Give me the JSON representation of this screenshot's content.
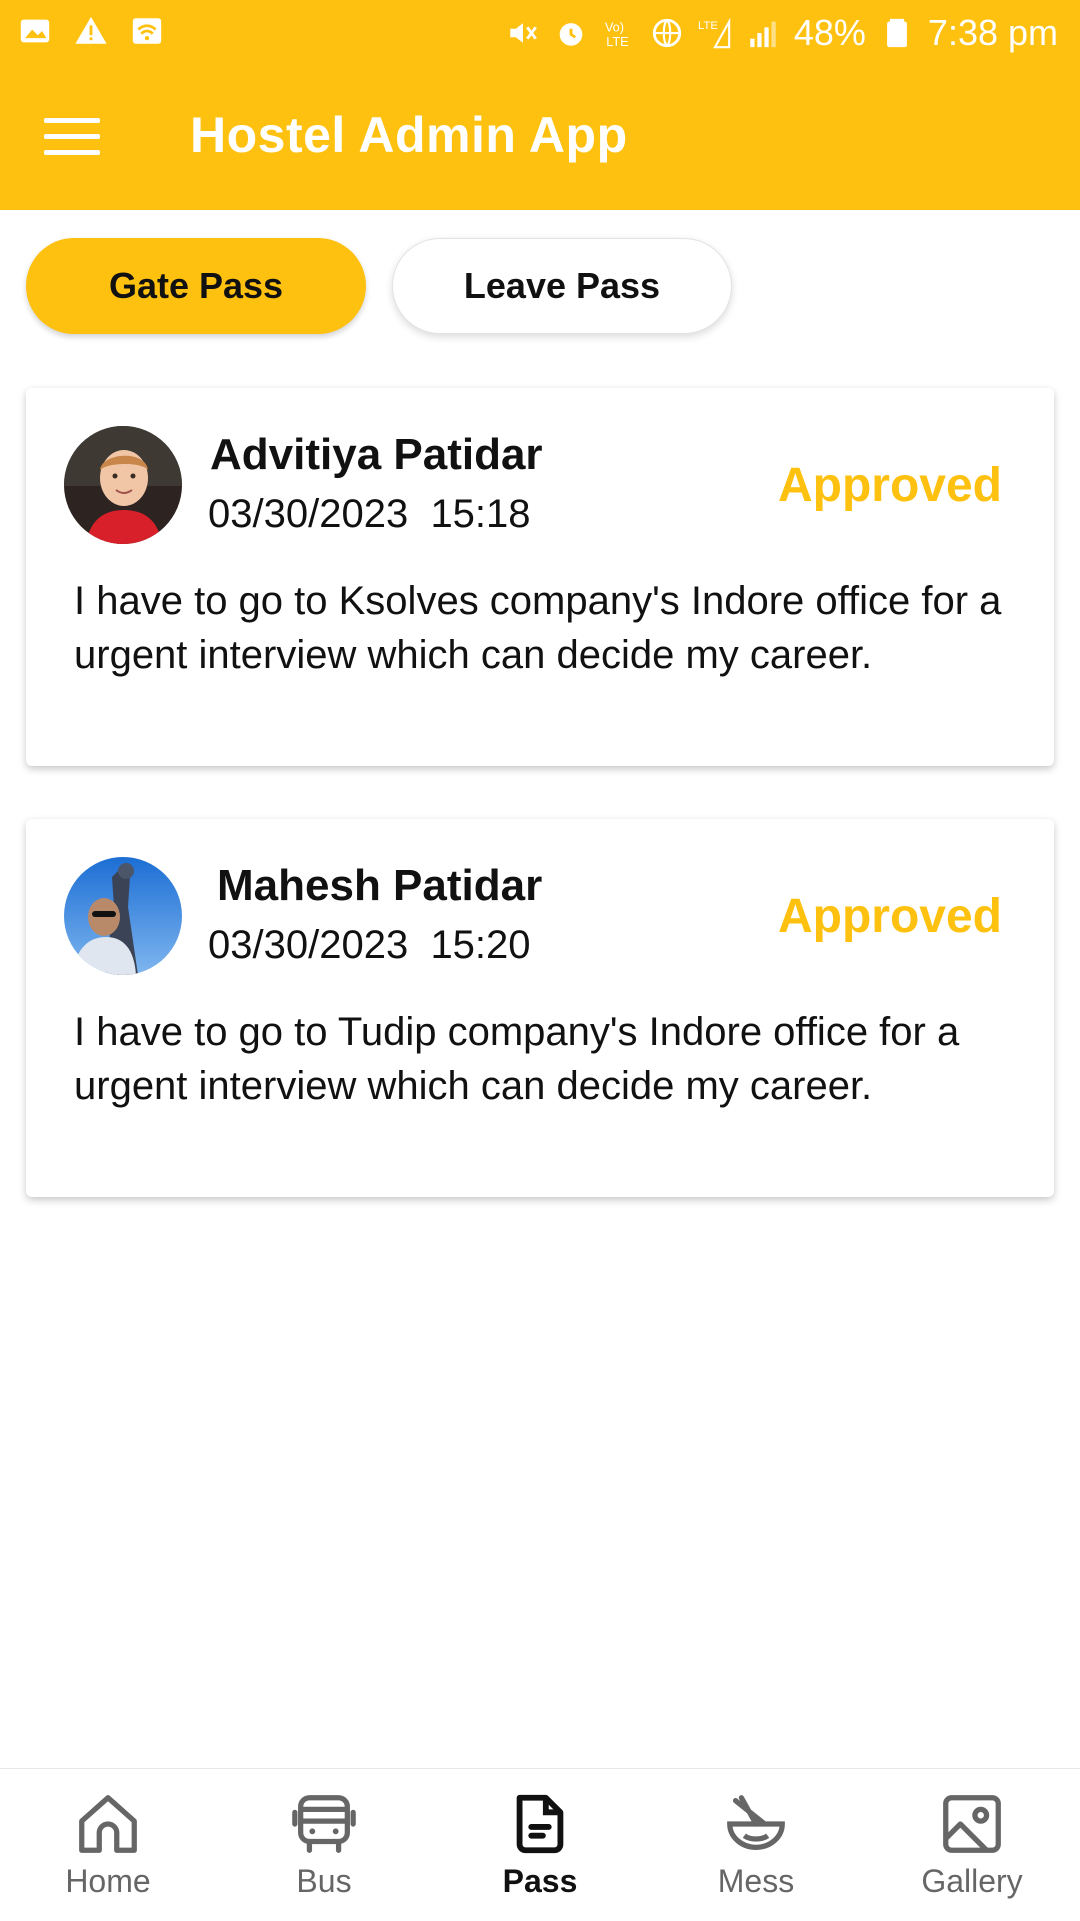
{
  "status_bar": {
    "battery": "48%",
    "time": "7:38 pm",
    "left_icons": [
      "gallery-icon",
      "warning-icon",
      "wifi-icon"
    ],
    "right_icons": [
      "mute-icon",
      "alarm-icon",
      "volte-icon",
      "data-icon",
      "lte-signal-icon",
      "signal-icon",
      "battery-icon"
    ]
  },
  "app_bar": {
    "title": "Hostel Admin App",
    "menu_icon": "menu-icon"
  },
  "tabs": [
    {
      "label": "Gate Pass",
      "active": true
    },
    {
      "label": "Leave Pass",
      "active": false
    }
  ],
  "passes": [
    {
      "name": "Advitiya Patidar",
      "date": "03/30/2023",
      "time": "15:18",
      "status": "Approved",
      "reason": "I have to go to Ksolves company's Indore office for a urgent interview which can decide my career."
    },
    {
      "name": "Mahesh Patidar",
      "date": "03/30/2023",
      "time": "15:20",
      "status": "Approved",
      "reason": "I have to go to Tudip company's Indore office for a urgent interview which can decide my career."
    }
  ],
  "bottom_nav": [
    {
      "label": "Home",
      "icon": "home-icon"
    },
    {
      "label": "Bus",
      "icon": "bus-icon"
    },
    {
      "label": "Pass",
      "icon": "document-icon",
      "active": true
    },
    {
      "label": "Mess",
      "icon": "bowl-icon"
    },
    {
      "label": "Gallery",
      "icon": "image-icon"
    }
  ],
  "colors": {
    "accent": "#FEC10F",
    "text": "#111111",
    "nav_inactive": "#666666"
  }
}
